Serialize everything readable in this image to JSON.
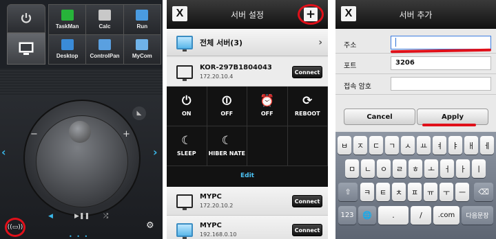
{
  "remote": {
    "shortcuts": [
      {
        "label": "TaskMan",
        "icon": "taskmanager-icon",
        "color": "#27b33a"
      },
      {
        "label": "Calc",
        "icon": "calculator-icon",
        "color": "#c8c8c8"
      },
      {
        "label": "Run",
        "icon": "run-icon",
        "color": "#4a9be0"
      },
      {
        "label": "Desktop",
        "icon": "desktop-icon",
        "color": "#3a8bd8"
      },
      {
        "label": "ControlPan",
        "icon": "control-panel-icon",
        "color": "#5aa0e0"
      },
      {
        "label": "MyCom",
        "icon": "my-computer-icon",
        "color": "#6fb2e8"
      }
    ],
    "minus": "−",
    "plus": "+",
    "play_pause": "▶❚❚"
  },
  "servers": {
    "title": "서버 설정",
    "close_label": "X",
    "add_label": "+",
    "all_servers": "전체 서버(3)",
    "selected": {
      "name": "KOR-297B1804043",
      "ip": "172.20.10.4",
      "connect": "Connect"
    },
    "actions": [
      {
        "label": "ON",
        "icon": "⏻"
      },
      {
        "label": "OFF",
        "icon": "⏼"
      },
      {
        "label": "OFF",
        "icon": "⏰"
      },
      {
        "label": "REBOOT",
        "icon": "⟳"
      },
      {
        "label": "SLEEP",
        "icon": "☾"
      },
      {
        "label": "HIBER NATE",
        "icon": "☾"
      },
      {
        "label": "",
        "icon": ""
      },
      {
        "label": "",
        "icon": ""
      }
    ],
    "edit_label": "Edit",
    "list": [
      {
        "name": "MYPC",
        "ip": "172.20.10.2",
        "connect": "Connect"
      },
      {
        "name": "MYPC",
        "ip": "192.168.0.10",
        "connect": "Connect"
      }
    ]
  },
  "add_server": {
    "title": "서버 추가",
    "close_label": "X",
    "fields": [
      {
        "label": "주소",
        "value": ""
      },
      {
        "label": "포트",
        "value": "3206"
      },
      {
        "label": "접속 암호",
        "value": ""
      }
    ],
    "cancel": "Cancel",
    "apply": "Apply",
    "keyboard": {
      "row1": [
        "ㅂ",
        "ㅈ",
        "ㄷ",
        "ㄱ",
        "ㅅ",
        "ㅛ",
        "ㅕ",
        "ㅑ",
        "ㅐ",
        "ㅔ"
      ],
      "row2": [
        "ㅁ",
        "ㄴ",
        "ㅇ",
        "ㄹ",
        "ㅎ",
        "ㅗ",
        "ㅓ",
        "ㅏ",
        "ㅣ"
      ],
      "row3": [
        "ㅋ",
        "ㅌ",
        "ㅊ",
        "ㅍ",
        "ㅠ",
        "ㅜ",
        "ㅡ"
      ],
      "shift": "⇧",
      "delete": "⌫",
      "numbers": "123",
      "globe": "🌐",
      "dot": ".",
      "slash": "/",
      "com": ".com",
      "next": "다음문장"
    }
  }
}
